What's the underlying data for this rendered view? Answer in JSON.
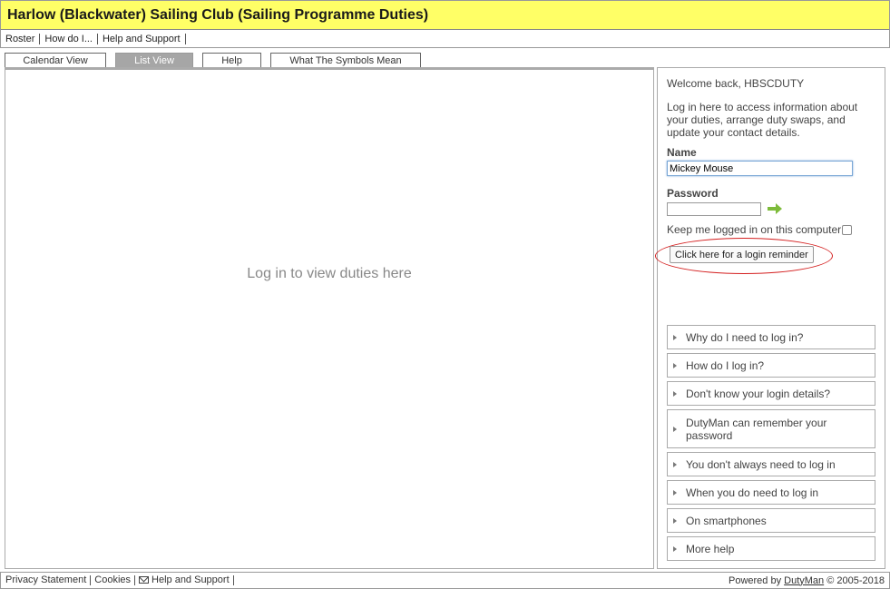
{
  "header": {
    "title": "Harlow (Blackwater) Sailing Club (Sailing Programme Duties)"
  },
  "topnav": {
    "items": [
      "Roster",
      "How do I...",
      "Help and Support"
    ]
  },
  "tabs": [
    {
      "label": "Calendar View"
    },
    {
      "label": "List View"
    },
    {
      "label": "Help"
    },
    {
      "label": "What The Symbols Mean"
    }
  ],
  "main": {
    "placeholder": "Log in to view duties here"
  },
  "login": {
    "welcome": "Welcome back, HBSCDUTY",
    "intro": "Log in here to access information about your duties, arrange duty swaps, and update your contact details.",
    "name_label": "Name",
    "name_value": "Mickey Mouse",
    "password_label": "Password",
    "password_value": "",
    "keep_logged_in": "Keep me logged in on this computer",
    "reminder_button": "Click here for a login reminder"
  },
  "faq": [
    "Why do I need to log in?",
    "How do I log in?",
    "Don't know your login details?",
    "DutyMan can remember your password",
    "You don't always need to log in",
    "When you do need to log in",
    "On smartphones",
    "More help"
  ],
  "footer": {
    "links": [
      "Privacy Statement",
      "Cookies",
      "Help and Support"
    ],
    "powered_prefix": "Powered by",
    "powered_link": "DutyMan",
    "copyright": "© 2005-2018"
  }
}
